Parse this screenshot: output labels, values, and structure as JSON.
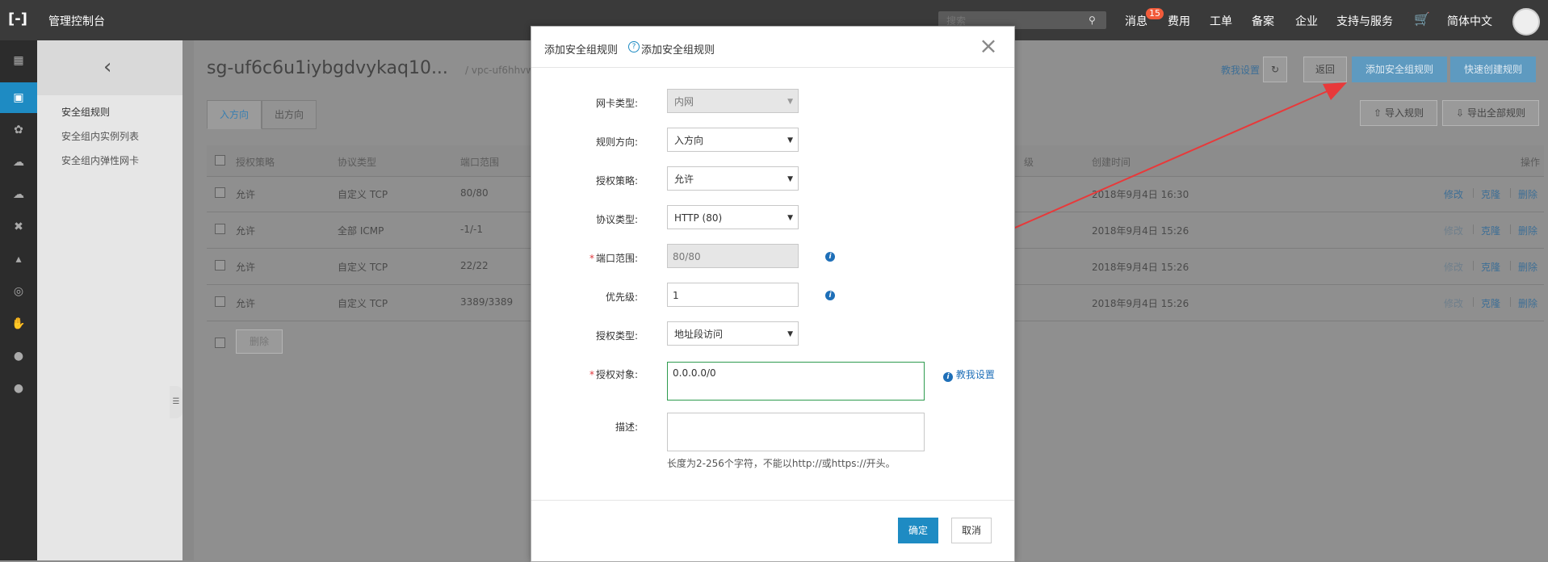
{
  "topbar": {
    "brand": "管理控制台",
    "search_placeholder": "搜索",
    "nav": [
      "消息",
      "费用",
      "工单",
      "备案",
      "企业",
      "支持与服务",
      "简体中文"
    ],
    "badge": "15"
  },
  "subnav": {
    "items": [
      "安全组规则",
      "安全组内实例列表",
      "安全组内弹性网卡"
    ]
  },
  "page": {
    "title": "sg-uf6c6u1iybgdvykaq10...",
    "vpc": "/ vpc-uf6hhvw6gyt",
    "help_link": "教我设置",
    "back_button": "返回",
    "add_rule_button": "添加安全组规则",
    "quick_rule_button": "快速创建规则",
    "import_button": "导入规则",
    "export_button": "导出全部规则"
  },
  "tabs": [
    "入方向",
    "出方向"
  ],
  "table": {
    "headers": [
      "授权策略",
      "协议类型",
      "端口范围",
      "级",
      "创建时间",
      "操作"
    ],
    "rows": [
      {
        "policy": "允许",
        "protocol": "自定义 TCP",
        "port": "80/80",
        "created": "2018年9月4日 16:30"
      },
      {
        "policy": "允许",
        "protocol": "全部 ICMP",
        "port": "-1/-1",
        "created": "2018年9月4日 15:26"
      },
      {
        "policy": "允许",
        "protocol": "自定义 TCP",
        "port": "22/22",
        "created": "2018年9月4日 15:26"
      },
      {
        "policy": "允许",
        "protocol": "自定义 TCP",
        "port": "3389/3389",
        "created": "2018年9月4日 15:26"
      }
    ],
    "actions": [
      "修改",
      "克隆",
      "删除"
    ],
    "delete_button": "删除"
  },
  "modal": {
    "title": "添加安全组规则",
    "subtitle": "添加安全组规则",
    "fields": {
      "nic_type": {
        "label": "网卡类型:",
        "value": "内网"
      },
      "direction": {
        "label": "规则方向:",
        "value": "入方向"
      },
      "policy": {
        "label": "授权策略:",
        "value": "允许"
      },
      "protocol": {
        "label": "协议类型:",
        "value": "HTTP (80)"
      },
      "port": {
        "label": "端口范围:",
        "value": "80/80"
      },
      "priority": {
        "label": "优先级:",
        "value": "1"
      },
      "auth_type": {
        "label": "授权类型:",
        "value": "地址段访问"
      },
      "auth_object": {
        "label": "授权对象:",
        "value": "0.0.0.0/0"
      },
      "desc": {
        "label": "描述:",
        "value": "",
        "hint": "长度为2-256个字符，不能以http://或https://开头。"
      }
    },
    "help_link": "教我设置",
    "confirm": "确定",
    "cancel": "取消"
  },
  "colors": {
    "accent": "#1e8bc3",
    "arrow": "#e8393a",
    "focus": "#2e9b4e"
  }
}
